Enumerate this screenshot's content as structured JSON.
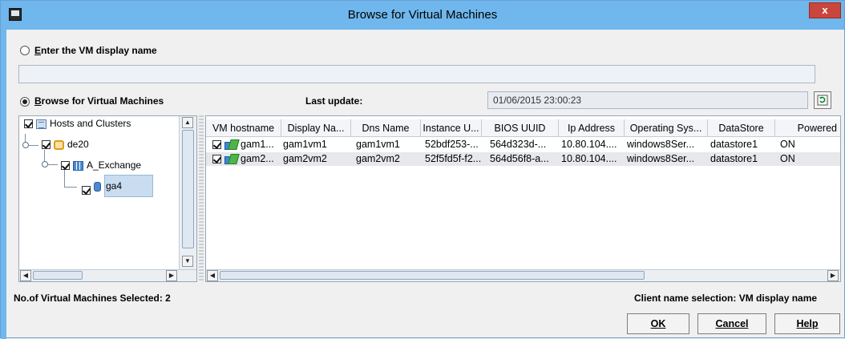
{
  "window": {
    "title": "Browse for Virtual Machines",
    "close_glyph": "x"
  },
  "options": {
    "vm_name_label": "Enter the VM display name",
    "browse_label": "Browse for Virtual Machines",
    "selected": "browse",
    "vm_name_value": ""
  },
  "last_update": {
    "label": "Last update:",
    "value": "01/06/2015 23:00:23"
  },
  "tree": [
    {
      "label": "Hosts and Clusters",
      "icon": "host-icon",
      "checked": true,
      "level": 0
    },
    {
      "label": "de20",
      "icon": "datacenter-icon",
      "checked": true,
      "level": 1
    },
    {
      "label": "A_Exchange",
      "icon": "cluster-icon",
      "checked": true,
      "level": 2
    },
    {
      "label": "ga4",
      "icon": "datastore-icon",
      "checked": true,
      "level": 3,
      "selected": true
    }
  ],
  "grid": {
    "columns": [
      "VM hostname",
      "Display Na...",
      "Dns Name",
      "Instance U...",
      "BIOS UUID",
      "Ip Address",
      "Operating Sys...",
      "DataStore",
      "Powered"
    ],
    "rows": [
      {
        "checked": true,
        "cells": [
          "gam1...",
          "gam1vm1",
          "gam1vm1",
          "52bdf253-...",
          "564d323d-...",
          "10.80.104....",
          "windows8Ser...",
          "datastore1",
          "ON"
        ]
      },
      {
        "checked": true,
        "cells": [
          "gam2...",
          "gam2vm2",
          "gam2vm2",
          "52f5fd5f-f2...",
          "564d56f8-a...",
          "10.80.104....",
          "windows8Ser...",
          "datastore1",
          "ON"
        ]
      }
    ]
  },
  "footer": {
    "selected_count": "No.of Virtual Machines Selected: 2",
    "client_name": "Client name selection: VM display name"
  },
  "buttons": {
    "ok": "OK",
    "cancel": "Cancel",
    "help": "Help"
  },
  "icons": {
    "refresh": "refresh-icon",
    "scroll_left": "◀",
    "scroll_right": "▶",
    "scroll_up": "▲",
    "scroll_down": "▼"
  }
}
